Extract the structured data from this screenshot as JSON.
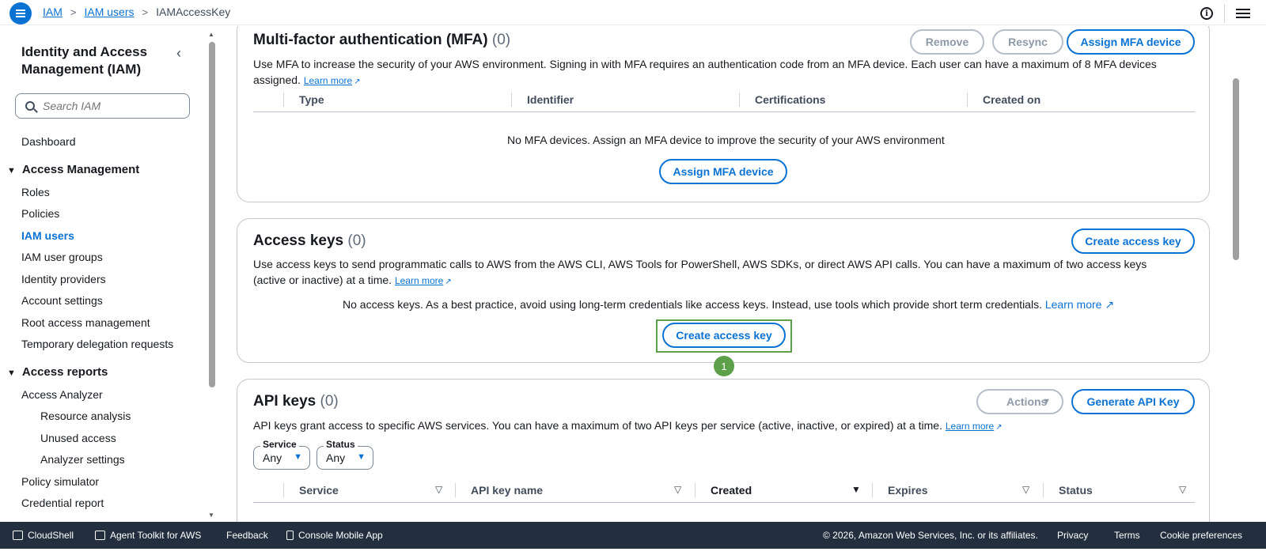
{
  "topbar": {
    "breadcrumb": [
      "IAM",
      "IAM users",
      "IAMAccessKey"
    ],
    "sep": ">"
  },
  "sidebar": {
    "title": "Identity and Access Management (IAM)",
    "search_placeholder": "Search IAM",
    "dashboard": "Dashboard",
    "access_management": {
      "label": "Access Management",
      "items": [
        "Roles",
        "Policies",
        "IAM users",
        "IAM user groups",
        "Identity providers",
        "Account settings",
        "Root access management",
        "Temporary delegation requests"
      ]
    },
    "access_reports": {
      "label": "Access reports",
      "items": [
        "Access Analyzer",
        "Resource analysis",
        "Unused access",
        "Analyzer settings",
        "Policy simulator",
        "Credential report"
      ]
    }
  },
  "mfa": {
    "title": "Multi-factor authentication (MFA)",
    "count": "(0)",
    "remove_label": "Remove",
    "resync_label": "Resync",
    "assign_label": "Assign MFA device",
    "description": "Use MFA to increase the security of your AWS environment. Signing in with MFA requires an authentication code from an MFA device. Each user can have a maximum of 8 MFA devices assigned.",
    "learn_more": "Learn more",
    "columns": [
      "Type",
      "Identifier",
      "Certifications",
      "Created on"
    ],
    "empty_text": "No MFA devices. Assign an MFA device to improve the security of your AWS environment",
    "empty_button": "Assign MFA device"
  },
  "access_keys": {
    "title": "Access keys",
    "count": "(0)",
    "create_label": "Create access key",
    "description": "Use access keys to send programmatic calls to AWS from the AWS CLI, AWS Tools for PowerShell, AWS SDKs, or direct AWS API calls. You can have a maximum of two access keys (active or inactive) at a time.",
    "learn_more": "Learn more",
    "empty_text": "No access keys. As a best practice, avoid using long-term credentials like access keys. Instead, use tools which provide short term credentials.",
    "empty_learn_more": "Learn more",
    "empty_button": "Create access key",
    "step_number": "1"
  },
  "api_keys": {
    "title": "API keys",
    "count": "(0)",
    "actions_label": "Actions",
    "generate_label": "Generate API Key",
    "description": "API keys grant access to specific AWS services. You can have a maximum of two API keys per service (active, inactive, or expired) at a time.",
    "learn_more": "Learn more",
    "filters": [
      {
        "label": "Service",
        "value": "Any"
      },
      {
        "label": "Status",
        "value": "Any"
      }
    ],
    "columns": [
      "Service",
      "API key name",
      "Created",
      "Expires",
      "Status"
    ]
  },
  "footer": {
    "cloudshell": "CloudShell",
    "agent_toolkit": "Agent Toolkit for AWS",
    "feedback": "Feedback",
    "mobile_app": "Console Mobile App",
    "copyright": "© 2026, Amazon Web Services, Inc. or its affiliates.",
    "privacy": "Privacy",
    "terms": "Terms",
    "cookies": "Cookie preferences"
  },
  "colors": {
    "accent": "#0972d3",
    "highlight": "#5ca04a",
    "footer_bg": "#232f3e"
  }
}
